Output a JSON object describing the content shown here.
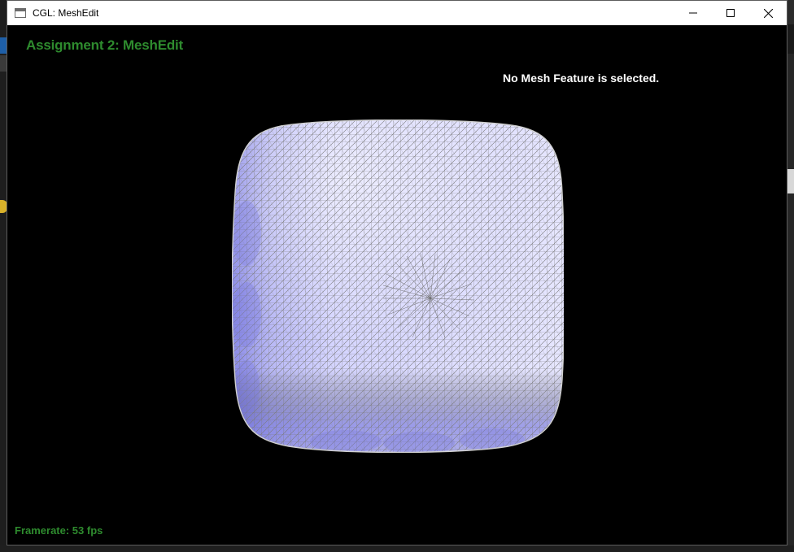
{
  "window": {
    "title": "CGL: MeshEdit",
    "icon": "app-window-icon",
    "controls": [
      "minimize-icon",
      "maximize-icon",
      "close-icon"
    ]
  },
  "hud": {
    "assignment_title": "Assignment 2: MeshEdit",
    "selection_status": "No Mesh Feature is selected.",
    "framerate": "Framerate: 53 fps"
  },
  "colors": {
    "hud_green": "#2e8b2e",
    "mesh_fill": "#c8c8ff",
    "mesh_shadow": "#8c8ce6",
    "wire": "#7a7a7a",
    "background": "#000000"
  }
}
